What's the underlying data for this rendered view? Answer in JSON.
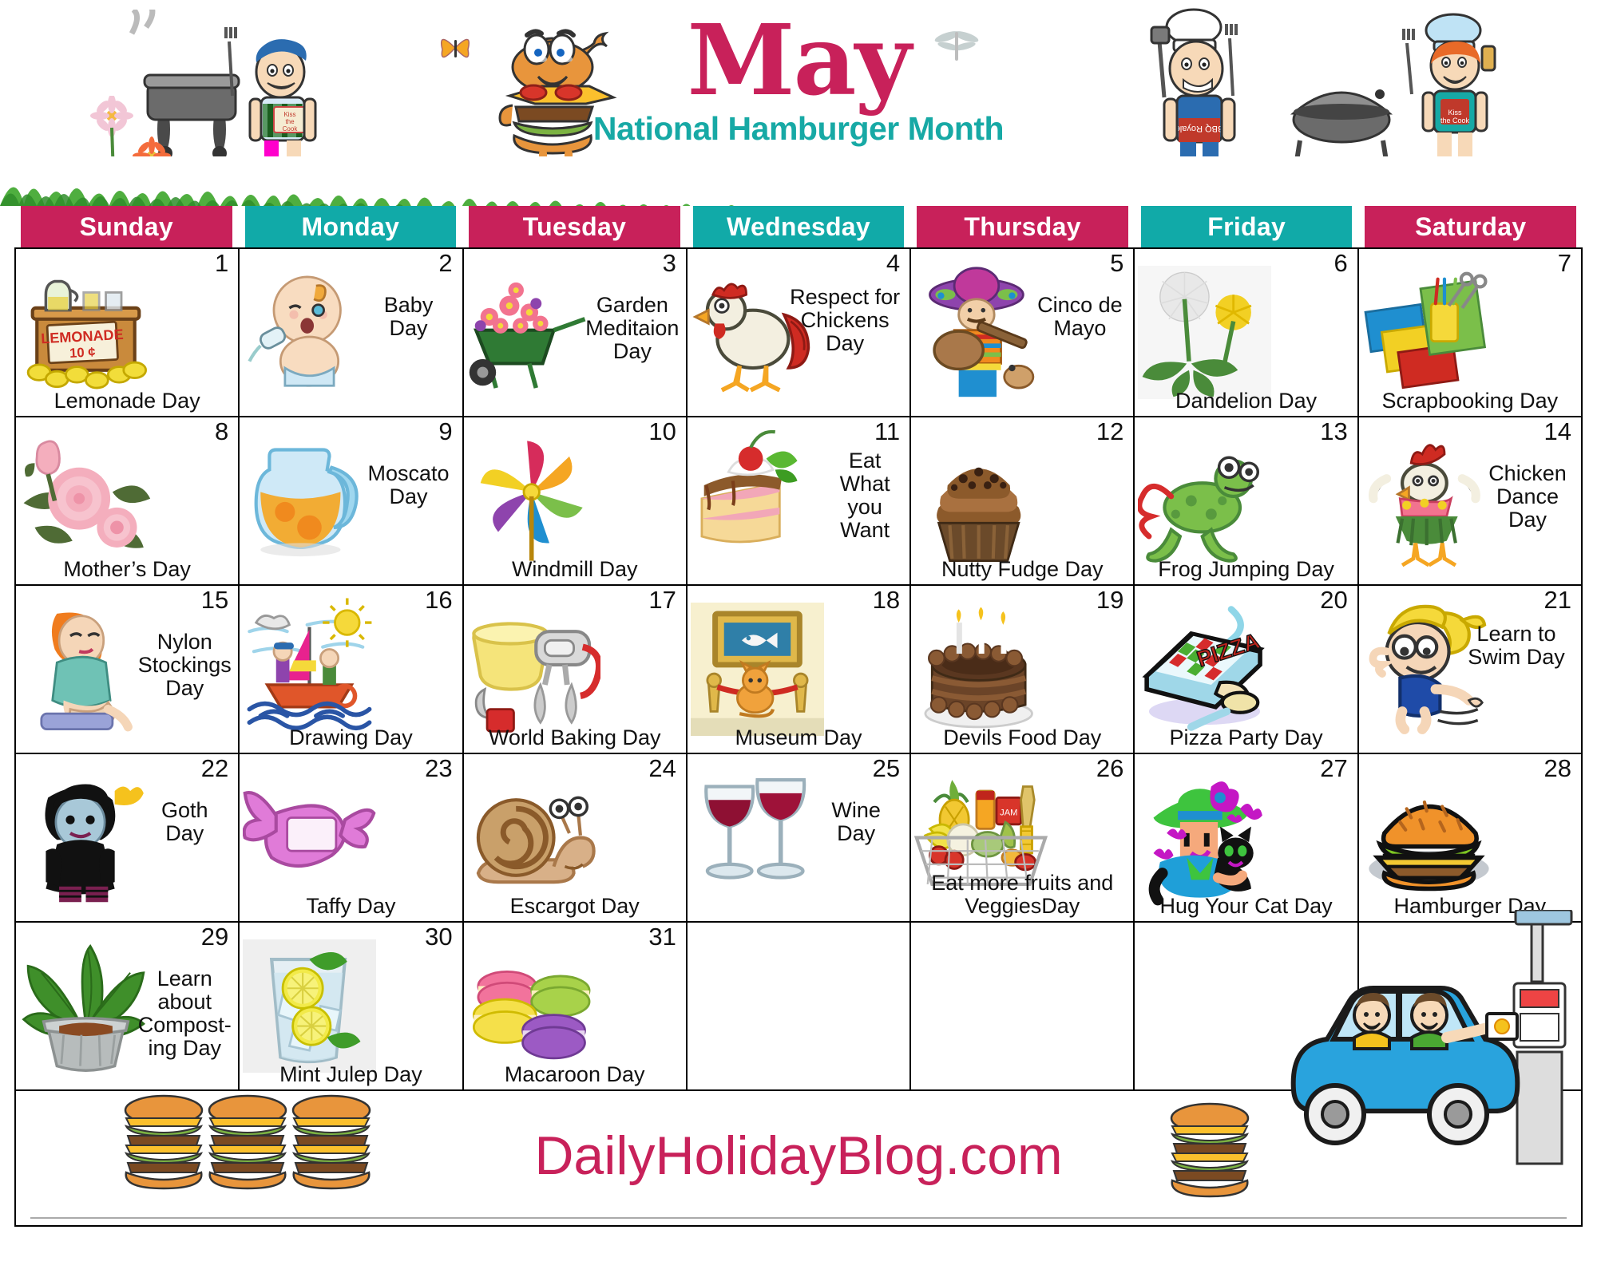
{
  "header": {
    "month": "May",
    "subtitle": "National Hamburger Month",
    "art": [
      {
        "name": "grill-chef-man-art"
      },
      {
        "name": "butterfly-art"
      },
      {
        "name": "flower-art"
      },
      {
        "name": "hamburger-mascot-art"
      },
      {
        "name": "dragonfly-art"
      },
      {
        "name": "bbq-royale-chef-art"
      },
      {
        "name": "grill-woman-art"
      }
    ],
    "colors": {
      "title_pink": "#c8215a",
      "subtitle_teal": "#17a9a5",
      "header_pink": "#c8215a",
      "header_teal": "#11aaa8"
    }
  },
  "weekdays": [
    {
      "label": "Sunday",
      "color": "pink"
    },
    {
      "label": "Monday",
      "color": "teal"
    },
    {
      "label": "Tuesday",
      "color": "pink"
    },
    {
      "label": "Wednesday",
      "color": "teal"
    },
    {
      "label": "Thursday",
      "color": "pink"
    },
    {
      "label": "Friday",
      "color": "teal"
    },
    {
      "label": "Saturday",
      "color": "pink"
    }
  ],
  "weeks": [
    [
      {
        "day": "1",
        "holiday": "Lemonade Day",
        "icon": "lemonade-stand-icon",
        "pos": "bottom"
      },
      {
        "day": "2",
        "holiday": "Baby\nDay",
        "icon": "baby-icon",
        "pos": "right"
      },
      {
        "day": "3",
        "holiday": "Garden\nMeditaion\nDay",
        "icon": "wheelbarrow-flowers-icon",
        "pos": "right"
      },
      {
        "day": "4",
        "holiday": "Respect for\nChickens\nDay",
        "icon": "chicken-icon",
        "pos": "rightwide"
      },
      {
        "day": "5",
        "holiday": "Cinco de\nMayo",
        "icon": "mariachi-icon",
        "pos": "right"
      },
      {
        "day": "6",
        "holiday": "Dandelion Day",
        "icon": "dandelion-icon",
        "pos": "bottom"
      },
      {
        "day": "7",
        "holiday": "Scrapbooking Day",
        "icon": "scrapbook-icon",
        "pos": "bottom"
      }
    ],
    [
      {
        "day": "8",
        "holiday": "Mother’s Day",
        "icon": "roses-icon",
        "pos": "bottom"
      },
      {
        "day": "9",
        "holiday": "Moscato\nDay",
        "icon": "juice-pitcher-icon",
        "pos": "right"
      },
      {
        "day": "10",
        "holiday": "Windmill Day",
        "icon": "pinwheel-icon",
        "pos": "bottom"
      },
      {
        "day": "11",
        "holiday": "Eat\nWhat\nyou\nWant",
        "icon": "cake-slice-icon",
        "pos": "rightnarrow"
      },
      {
        "day": "12",
        "holiday": "Nutty Fudge Day",
        "icon": "cupcake-icon",
        "pos": "bottom"
      },
      {
        "day": "13",
        "holiday": "Frog Jumping Day",
        "icon": "frog-icon",
        "pos": "bottom"
      },
      {
        "day": "14",
        "holiday": "Chicken\nDance\nDay",
        "icon": "hula-chicken-icon",
        "pos": "right"
      }
    ],
    [
      {
        "day": "15",
        "holiday": "Nylon\nStockings\nDay",
        "icon": "woman-stockings-icon",
        "pos": "right"
      },
      {
        "day": "16",
        "holiday": "Drawing Day",
        "icon": "sailboat-drawing-icon",
        "pos": "bottom"
      },
      {
        "day": "17",
        "holiday": "World Baking Day",
        "icon": "mixer-icon",
        "pos": "bottom"
      },
      {
        "day": "18",
        "holiday": "Museum Day",
        "icon": "museum-fish-icon",
        "pos": "bottom"
      },
      {
        "day": "19",
        "holiday": "Devils Food Day",
        "icon": "chocolate-cake-icon",
        "pos": "bottom"
      },
      {
        "day": "20",
        "holiday": "Pizza Party Day",
        "icon": "pizza-box-icon",
        "pos": "bottom"
      },
      {
        "day": "21",
        "holiday": "Learn to\nSwim Day",
        "icon": "swimmer-kid-icon",
        "pos": "rightwide"
      }
    ],
    [
      {
        "day": "22",
        "holiday": "Goth\nDay",
        "icon": "goth-girl-icon",
        "pos": "right"
      },
      {
        "day": "23",
        "holiday": "Taffy Day",
        "icon": "taffy-icon",
        "pos": "bottom"
      },
      {
        "day": "24",
        "holiday": "Escargot Day",
        "icon": "snail-icon",
        "pos": "bottom"
      },
      {
        "day": "25",
        "holiday": "Wine\nDay",
        "icon": "wine-glasses-icon",
        "pos": "right"
      },
      {
        "day": "26",
        "holiday": "Eat more fruits and\nVeggiesDay",
        "icon": "grocery-basket-icon",
        "pos": "bottom"
      },
      {
        "day": "27",
        "holiday": "Hug Your Cat  Day",
        "icon": "woman-cat-icon",
        "pos": "bottom"
      },
      {
        "day": "28",
        "holiday": "Hamburger  Day",
        "icon": "hamburger-plate-icon",
        "pos": "bottom"
      }
    ],
    [
      {
        "day": "29",
        "holiday": "Learn\nabout\nCompost-\ning  Day",
        "icon": "potted-plant-icon",
        "pos": "right"
      },
      {
        "day": "30",
        "holiday": "Mint Julep Day",
        "icon": "lime-drink-icon",
        "pos": "bottom"
      },
      {
        "day": "31",
        "holiday": "Macaroon Day",
        "icon": "macarons-icon",
        "pos": "bottom"
      },
      {
        "day": "",
        "holiday": "",
        "icon": "",
        "pos": "bottom"
      },
      {
        "day": "",
        "holiday": "",
        "icon": "",
        "pos": "bottom"
      },
      {
        "day": "",
        "holiday": "",
        "icon": "",
        "pos": "bottom"
      },
      {
        "day": "",
        "holiday": "",
        "icon": "drive-thru-car-art",
        "pos": "bottom"
      }
    ]
  ],
  "footer": {
    "site": "DailyHolidayBlog.com",
    "art": [
      {
        "name": "stacked-burgers-art"
      },
      {
        "name": "single-burger-art"
      },
      {
        "name": "drive-thru-car-art"
      }
    ]
  }
}
